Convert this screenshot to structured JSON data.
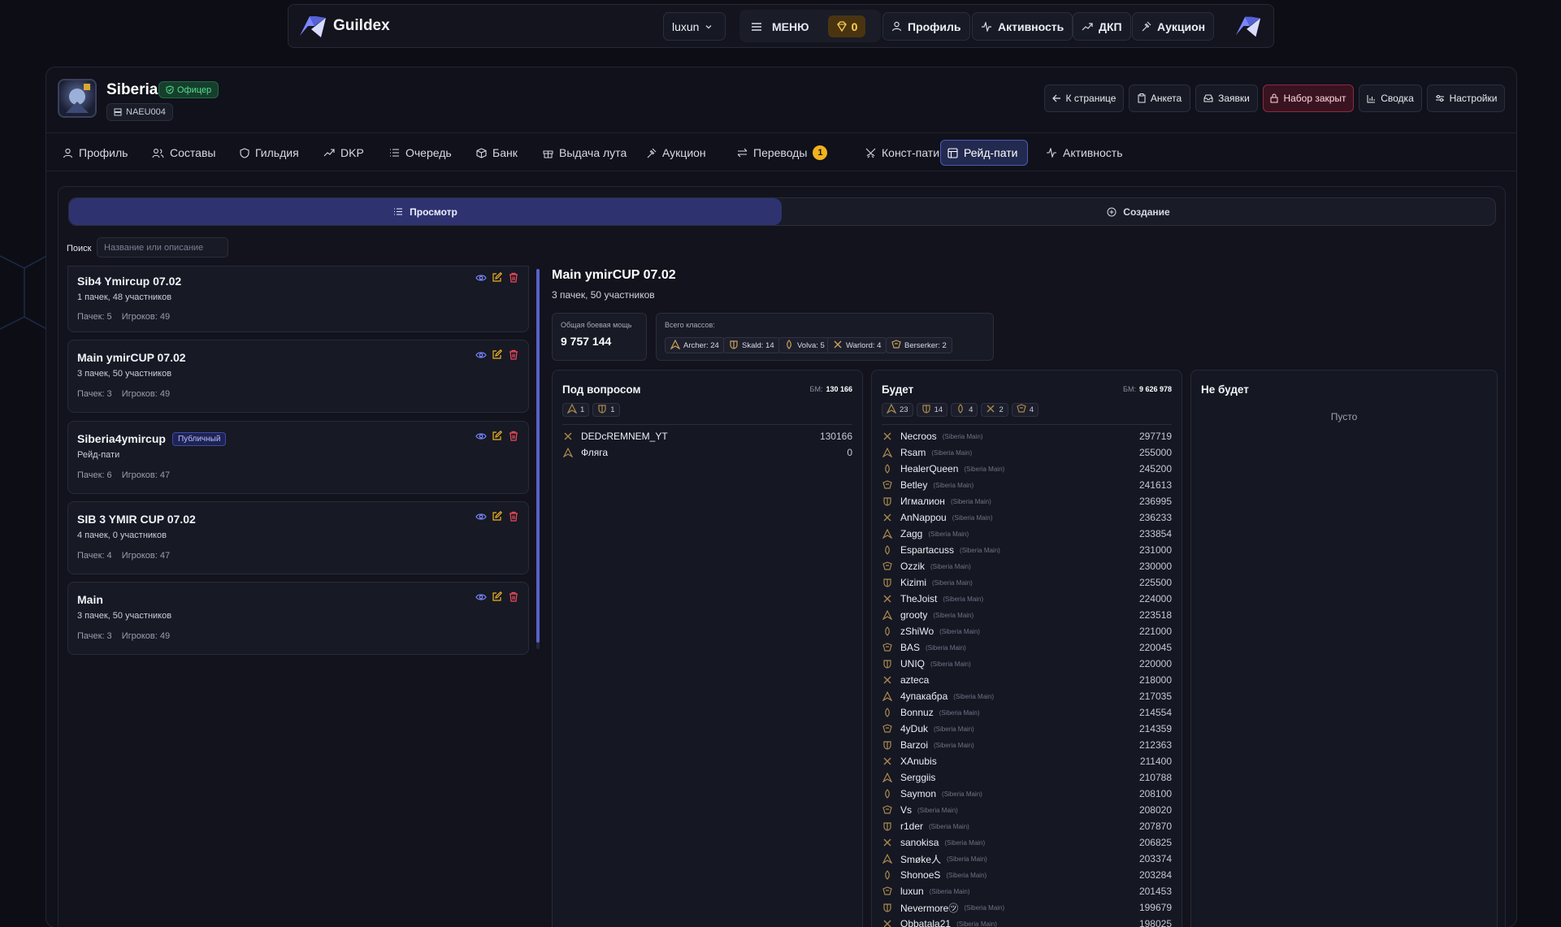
{
  "app": {
    "brand": "Guildex",
    "user": "luxun",
    "menu_label": "МЕНЮ",
    "gems": "0"
  },
  "topnav": [
    {
      "label": "Профиль",
      "icon": "user-icon"
    },
    {
      "label": "Активность",
      "icon": "activity-icon"
    },
    {
      "label": "ДКП",
      "icon": "trending-icon"
    },
    {
      "label": "Аукцион",
      "icon": "gavel-icon"
    }
  ],
  "guild": {
    "name": "Siberia",
    "role_badge": "Офицер",
    "region": "NAEU004"
  },
  "actions": [
    {
      "label": "К странице",
      "icon": "arrow-left-icon"
    },
    {
      "label": "Анкета",
      "icon": "clipboard-icon"
    },
    {
      "label": "Заявки",
      "icon": "inbox-icon"
    },
    {
      "label": "Набор закрыт",
      "icon": "lock-icon"
    },
    {
      "label": "Сводка",
      "icon": "bar-chart-icon"
    },
    {
      "label": "Настройки",
      "icon": "sliders-icon"
    }
  ],
  "tabs": [
    {
      "label": "Профиль",
      "icon": "user-icon"
    },
    {
      "label": "Составы",
      "icon": "users-icon"
    },
    {
      "label": "Гильдия",
      "icon": "shield-icon"
    },
    {
      "label": "DKP",
      "icon": "trending-icon"
    },
    {
      "label": "Очередь",
      "icon": "list-icon"
    },
    {
      "label": "Банк",
      "icon": "box-icon"
    },
    {
      "label": "Выдача лута",
      "icon": "gift-icon"
    },
    {
      "label": "Аукцион",
      "icon": "gavel-icon"
    },
    {
      "label": "Переводы",
      "icon": "transfer-icon",
      "badge": "1"
    },
    {
      "label": "Конст-пати",
      "icon": "swords-icon"
    },
    {
      "label": "Рейд-пати",
      "icon": "layout-icon",
      "active": true
    },
    {
      "label": "Активность",
      "icon": "activity-icon"
    }
  ],
  "mode": {
    "view": "Просмотр",
    "create": "Создание"
  },
  "search": {
    "label": "Поиск",
    "placeholder": "Название или описание"
  },
  "parties": [
    {
      "title": "Sib4 Ymircup 07.02",
      "desc": "1 пачек, 48 участников",
      "packs": "Пачек: 5",
      "players": "Игроков: 49"
    },
    {
      "title": "Main ymirCUP 07.02",
      "desc": "3 пачек, 50 участников",
      "packs": "Пачек: 3",
      "players": "Игроков: 49"
    },
    {
      "title": "Siberia4ymircup",
      "badge": "Публичный",
      "desc": "Рейд-пати",
      "packs": "Пачек: 6",
      "players": "Игроков: 47"
    },
    {
      "title": "SIB 3 YMIR CUP 07.02",
      "desc": "4 пачек, 0 участников",
      "packs": "Пачек: 4",
      "players": "Игроков: 47"
    },
    {
      "title": "Main",
      "desc": "3 пачек, 50 участников",
      "packs": "Пачек: 3",
      "players": "Игроков: 49"
    }
  ],
  "detail": {
    "title": "Main ymirCUP 07.02",
    "subtitle": "3 пачек, 50 участников",
    "power_label": "Общая боевая мощь",
    "power_value": "9 757 144",
    "classes_label": "Всего классов:",
    "classes": [
      {
        "label": "Archer: 24",
        "color": "#c9a25a"
      },
      {
        "label": "Skald: 14",
        "color": "#c9a25a"
      },
      {
        "label": "Volva: 5",
        "color": "#c9a25a"
      },
      {
        "label": "Warlord: 4",
        "color": "#c9a25a"
      },
      {
        "label": "Berserker: 2",
        "color": "#c9a25a"
      }
    ]
  },
  "panels": {
    "maybe": {
      "title": "Под вопросом",
      "bm_label": "БМ:",
      "bm_value": "130 166",
      "chips": [
        "1",
        "1"
      ],
      "rows": [
        {
          "name": "DEDcREMNEM_YT",
          "guild": "",
          "value": "130166"
        },
        {
          "name": "Фляга",
          "guild": "",
          "value": "0"
        }
      ]
    },
    "yes": {
      "title": "Будет",
      "bm_label": "БМ:",
      "bm_value": "9 626 978",
      "chips": [
        "23",
        "14",
        "4",
        "2",
        "4"
      ],
      "rows": [
        {
          "name": "Necroos",
          "guild": "(Siberia Main)",
          "value": "297719"
        },
        {
          "name": "Rsam",
          "guild": "(Siberia Main)",
          "value": "255000"
        },
        {
          "name": "HealerQueen",
          "guild": "(Siberia Main)",
          "value": "245200"
        },
        {
          "name": "Betley",
          "guild": "(Siberia Main)",
          "value": "241613"
        },
        {
          "name": "Игмалион",
          "guild": "(Siberia Main)",
          "value": "236995"
        },
        {
          "name": "AnNappou",
          "guild": "(Siberia Main)",
          "value": "236233"
        },
        {
          "name": "Zagg",
          "guild": "(Siberia Main)",
          "value": "233854"
        },
        {
          "name": "Espartacuss",
          "guild": "(Siberia Main)",
          "value": "231000"
        },
        {
          "name": "Ozzik",
          "guild": "(Siberia Main)",
          "value": "230000"
        },
        {
          "name": "Kizimi",
          "guild": "(Siberia Main)",
          "value": "225500"
        },
        {
          "name": "TheJoist",
          "guild": "(Siberia Main)",
          "value": "224000"
        },
        {
          "name": "grooty",
          "guild": "(Siberia Main)",
          "value": "223518"
        },
        {
          "name": "zShiWo",
          "guild": "(Siberia Main)",
          "value": "221000"
        },
        {
          "name": "BAS",
          "guild": "(Siberia Main)",
          "value": "220045"
        },
        {
          "name": "UNIQ",
          "guild": "(Siberia Main)",
          "value": "220000"
        },
        {
          "name": "azteca",
          "guild": "",
          "value": "218000"
        },
        {
          "name": "4упакабра",
          "guild": "(Siberia Main)",
          "value": "217035"
        },
        {
          "name": "Bonnuz",
          "guild": "(Siberia Main)",
          "value": "214554"
        },
        {
          "name": "4yDuk",
          "guild": "(Siberia Main)",
          "value": "214359"
        },
        {
          "name": "Barzoi",
          "guild": "(Siberia Main)",
          "value": "212363"
        },
        {
          "name": "XAnubis",
          "guild": "",
          "value": "211400"
        },
        {
          "name": "Serggiis",
          "guild": "",
          "value": "210788"
        },
        {
          "name": "Saymon",
          "guild": "(Siberia Main)",
          "value": "208100"
        },
        {
          "name": "Vs",
          "guild": "(Siberia Main)",
          "value": "208020"
        },
        {
          "name": "r1der",
          "guild": "(Siberia Main)",
          "value": "207870"
        },
        {
          "name": "sanokisa",
          "guild": "(Siberia Main)",
          "value": "206825"
        },
        {
          "name": "Smøke人",
          "guild": "(Siberia Main)",
          "value": "203374"
        },
        {
          "name": "ShonoeS",
          "guild": "(Siberia Main)",
          "value": "203284"
        },
        {
          "name": "luxun",
          "guild": "(Siberia Main)",
          "value": "201453"
        },
        {
          "name": "Nevermore㋡",
          "guild": "(Siberia Main)",
          "value": "199679"
        },
        {
          "name": "Obbatala21",
          "guild": "(Siberia Main)",
          "value": "198025"
        }
      ]
    },
    "no": {
      "title": "Не будет",
      "empty": "Пусто"
    }
  }
}
